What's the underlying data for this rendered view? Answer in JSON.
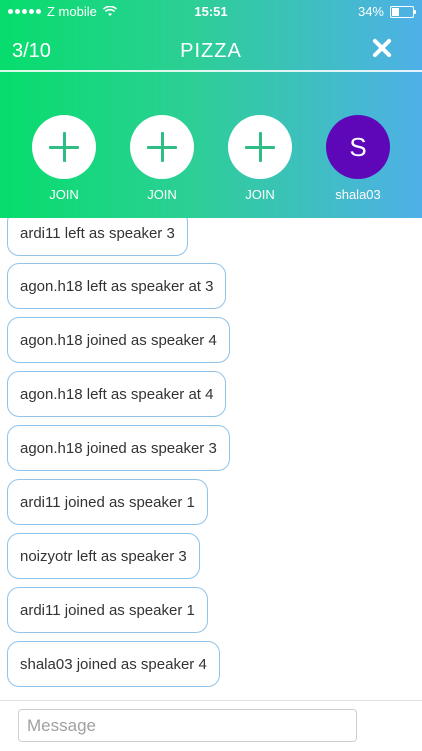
{
  "status_bar": {
    "carrier": "Z mobile",
    "time": "15:51",
    "battery": "34%"
  },
  "header": {
    "counter": "3/10",
    "title": "PIZZA"
  },
  "slots": [
    {
      "label": "JOIN",
      "icon": "plus-icon"
    },
    {
      "label": "JOIN",
      "icon": "plus-icon"
    },
    {
      "label": "JOIN",
      "icon": "plus-icon"
    },
    {
      "label": "shala03",
      "avatar_letter": "S",
      "avatar_color": "#5e07b8"
    }
  ],
  "messages": [
    "ardi11 left as speaker 3",
    "agon.h18 left as speaker at 3",
    "agon.h18 joined as speaker 4",
    "agon.h18 left as speaker at 4",
    "agon.h18 joined as speaker 3",
    "ardi11 joined as speaker 1",
    "noizyotr left as speaker 3",
    "ardi11 joined as speaker 1",
    "shala03 joined as speaker 4"
  ],
  "input": {
    "placeholder": "Message"
  }
}
